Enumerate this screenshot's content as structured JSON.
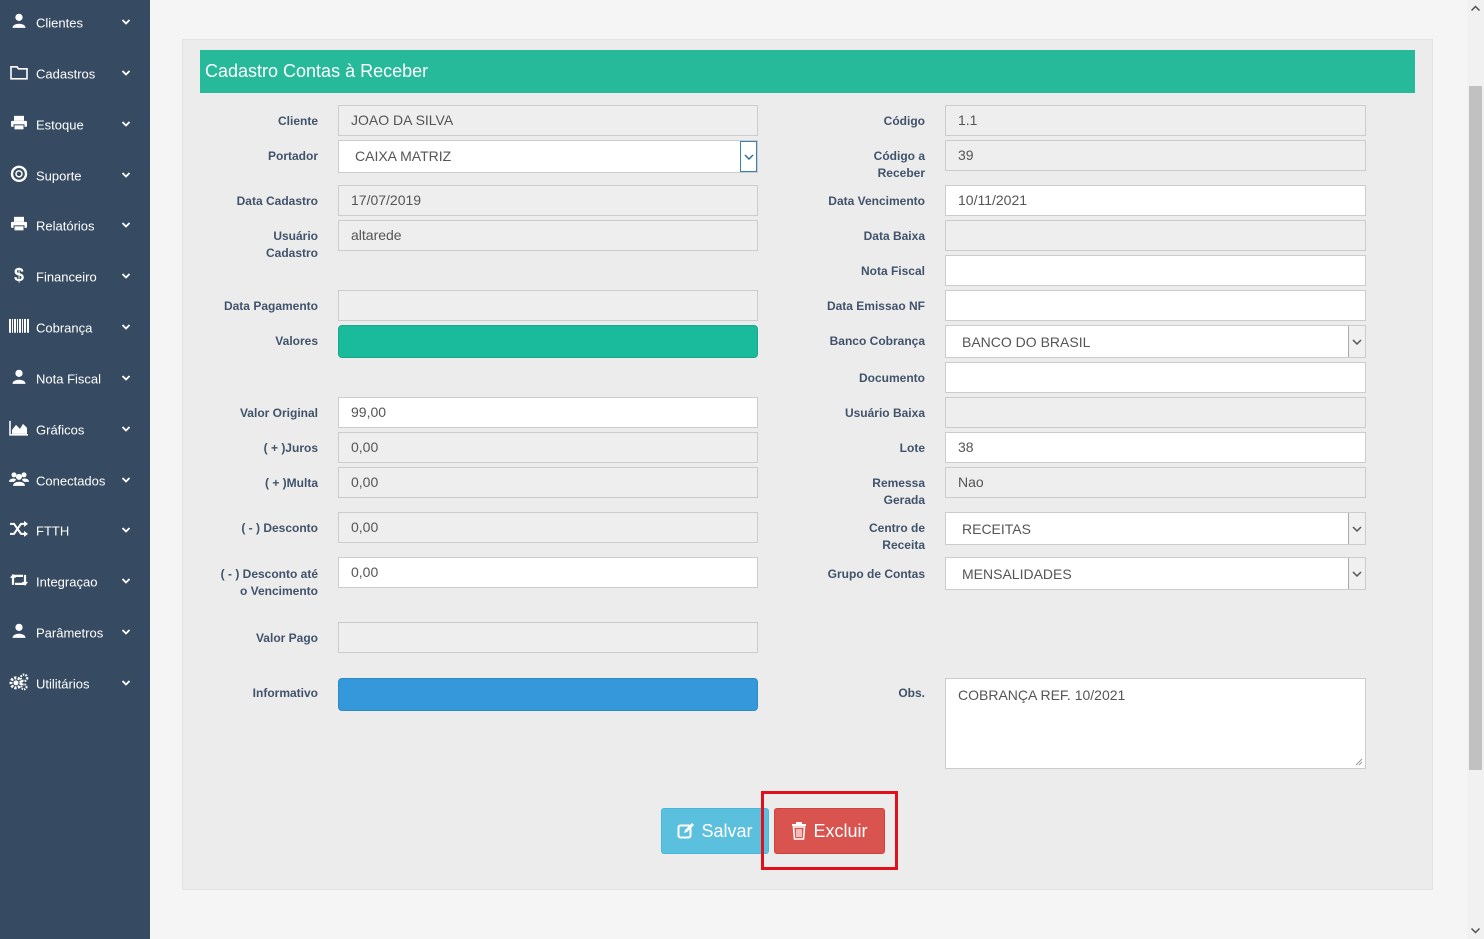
{
  "sidebar": {
    "items": [
      {
        "label": "Clientes",
        "icon": "user-icon"
      },
      {
        "label": "Cadastros",
        "icon": "folder-icon"
      },
      {
        "label": "Estoque",
        "icon": "printer-icon"
      },
      {
        "label": "Suporte",
        "icon": "lifebuoy-icon"
      },
      {
        "label": "Relatórios",
        "icon": "printer-icon"
      },
      {
        "label": "Financeiro",
        "icon": "dollar-icon"
      },
      {
        "label": "Cobrança",
        "icon": "barcode-icon"
      },
      {
        "label": "Nota Fiscal",
        "icon": "user-icon"
      },
      {
        "label": "Gráficos",
        "icon": "area-chart-icon"
      },
      {
        "label": "Conectados",
        "icon": "users-icon"
      },
      {
        "label": "FTTH",
        "icon": "random-icon"
      },
      {
        "label": "Integraçao",
        "icon": "retweet-icon"
      },
      {
        "label": "Parâmetros",
        "icon": "user-icon"
      },
      {
        "label": "Utilitários",
        "icon": "cogs-icon"
      }
    ]
  },
  "form": {
    "title": "Cadastro Contas à Receber",
    "left": {
      "cliente": {
        "label": "Cliente",
        "value": "JOAO DA SILVA"
      },
      "portador": {
        "label": "Portador",
        "value": "CAIXA MATRIZ"
      },
      "data_cadastro": {
        "label": "Data Cadastro",
        "value": "17/07/2019"
      },
      "usuario_cadastro": {
        "label_1": "Usuário",
        "label_2": "Cadastro",
        "value": "altarede"
      },
      "data_pagamento": {
        "label": "Data Pagamento",
        "value": ""
      },
      "valores": {
        "label": "Valores"
      },
      "valor_original": {
        "label": "Valor Original",
        "value": "99,00"
      },
      "juros": {
        "label": "( + )Juros",
        "value": "0,00"
      },
      "multa": {
        "label": "( + )Multa",
        "value": "0,00"
      },
      "desconto": {
        "label": "( - ) Desconto",
        "value": "0,00"
      },
      "desconto_vencimento": {
        "label_1": "( - ) Desconto até",
        "label_2": "o Vencimento",
        "value": "0,00"
      },
      "valor_pago": {
        "label": "Valor Pago",
        "value": ""
      },
      "informativo": {
        "label": "Informativo"
      }
    },
    "right": {
      "codigo": {
        "label": "Código",
        "value": "1.1"
      },
      "codigo_receber": {
        "label_1": "Código a",
        "label_2": "Receber",
        "value": "39"
      },
      "data_vencimento": {
        "label": "Data Vencimento",
        "value": "10/11/2021"
      },
      "data_baixa": {
        "label": "Data Baixa",
        "value": ""
      },
      "nota_fiscal": {
        "label": "Nota Fiscal",
        "value": ""
      },
      "data_emissao_nf": {
        "label": "Data Emissao NF",
        "value": ""
      },
      "banco_cobranca": {
        "label": "Banco Cobrança",
        "value": "BANCO DO BRASIL"
      },
      "documento": {
        "label": "Documento",
        "value": ""
      },
      "usuario_baixa": {
        "label": "Usuário Baixa",
        "value": ""
      },
      "lote": {
        "label": "Lote",
        "value": "38"
      },
      "remessa_gerada": {
        "label_1": "Remessa",
        "label_2": "Gerada",
        "value": "Nao"
      },
      "centro_receita": {
        "label_1": "Centro de",
        "label_2": "Receita",
        "value": "RECEITAS"
      },
      "grupo_contas": {
        "label": "Grupo de Contas",
        "value": "MENSALIDADES"
      },
      "obs": {
        "label": "Obs.",
        "value": "COBRANÇA REF. 10/2021"
      }
    },
    "buttons": {
      "salvar": "Salvar",
      "excluir": "Excluir"
    }
  },
  "colors": {
    "sidebar": "#364a61",
    "header": "#26b99a",
    "valores_bar": "#1abb9c",
    "informativo_bar": "#3498db",
    "salvar": "#5bc0de",
    "excluir": "#d9534f",
    "highlight": "#e0101c"
  }
}
